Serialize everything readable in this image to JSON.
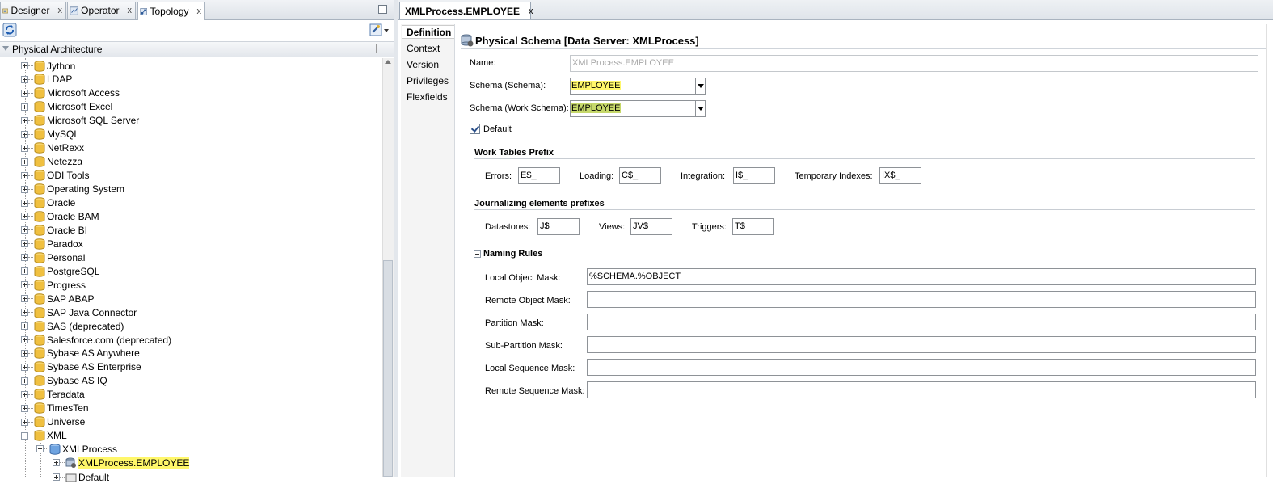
{
  "left_tabs": [
    {
      "label": "Designer",
      "close": "x"
    },
    {
      "label": "Operator",
      "close": "x"
    },
    {
      "label": "Topology",
      "close": "x"
    }
  ],
  "section_title": "Physical Architecture",
  "tree": {
    "technologies": [
      "Jython",
      "LDAP",
      "Microsoft Access",
      "Microsoft Excel",
      "Microsoft SQL Server",
      "MySQL",
      "NetRexx",
      "Netezza",
      "ODI Tools",
      "Operating System",
      "Oracle",
      "Oracle BAM",
      "Oracle BI",
      "Paradox",
      "Personal",
      "PostgreSQL",
      "Progress",
      "SAP ABAP",
      "SAP Java Connector",
      "SAS (deprecated)",
      "Salesforce.com (deprecated)",
      "Sybase AS Anywhere",
      "Sybase AS Enterprise",
      "Sybase AS IQ",
      "Teradata",
      "TimesTen",
      "Universe",
      "XML"
    ],
    "data_server": "XMLProcess",
    "schema": "XMLProcess.EMPLOYEE",
    "partial_next": "Default"
  },
  "editor_tab": {
    "label": "XMLProcess.EMPLOYEE",
    "close": "x"
  },
  "nav": [
    "Definition",
    "Context",
    "Version",
    "Privileges",
    "Flexfields"
  ],
  "header": {
    "title": "Physical Schema [Data Server: XMLProcess]"
  },
  "form": {
    "name_label": "Name:",
    "name_value": "XMLProcess.EMPLOYEE",
    "schema_label": "Schema (Schema):",
    "schema_value": "EMPLOYEE",
    "work_schema_label": "Schema (Work Schema):",
    "work_schema_value": "EMPLOYEE",
    "default_label": "Default"
  },
  "work_tables": {
    "title": "Work Tables Prefix",
    "errors_label": "Errors:",
    "errors_value": "E$_",
    "loading_label": "Loading:",
    "loading_value": "C$_",
    "integration_label": "Integration:",
    "integration_value": "I$_",
    "temp_label": "Temporary Indexes:",
    "temp_value": "IX$_"
  },
  "journalizing": {
    "title": "Journalizing elements prefixes",
    "datastores_label": "Datastores:",
    "datastores_value": "J$",
    "views_label": "Views:",
    "views_value": "JV$",
    "triggers_label": "Triggers:",
    "triggers_value": "T$"
  },
  "naming": {
    "title": "Naming Rules",
    "rows": [
      {
        "label": "Local Object Mask:",
        "value": "%SCHEMA.%OBJECT"
      },
      {
        "label": "Remote Object Mask:",
        "value": ""
      },
      {
        "label": "Partition Mask:",
        "value": ""
      },
      {
        "label": "Sub-Partition Mask:",
        "value": ""
      },
      {
        "label": "Local Sequence Mask:",
        "value": ""
      },
      {
        "label": "Remote Sequence Mask:",
        "value": ""
      }
    ]
  },
  "colors": {
    "highlight": "#fff76a",
    "selection_green": "#c6d86a",
    "tab_border": "#9aa6b4"
  }
}
